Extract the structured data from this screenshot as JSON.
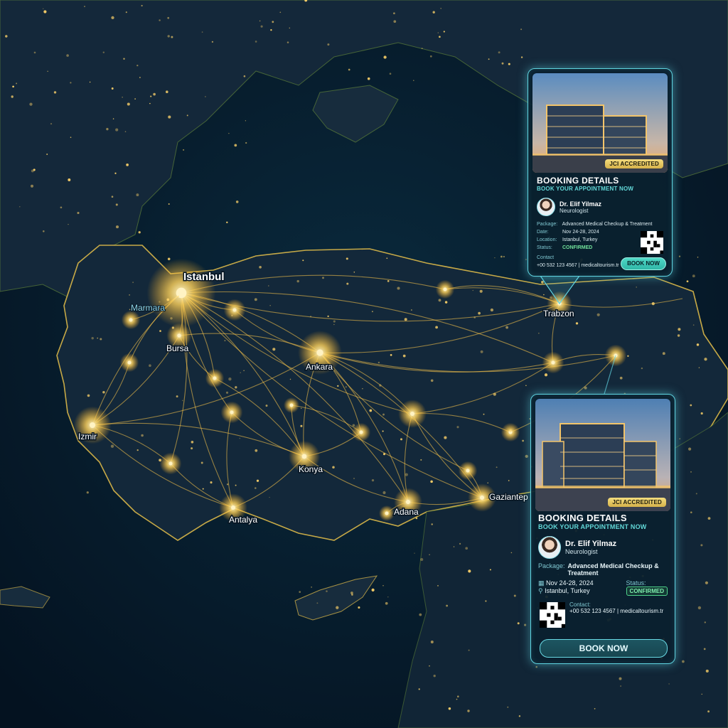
{
  "map": {
    "sea_label": "Marmara",
    "cities": [
      {
        "name": "Istanbul"
      },
      {
        "name": "Bursa"
      },
      {
        "name": "Izmir"
      },
      {
        "name": "Ankara"
      },
      {
        "name": "Konya"
      },
      {
        "name": "Antalya"
      },
      {
        "name": "Adana"
      },
      {
        "name": "Gaziantep"
      },
      {
        "name": "Trabzon"
      }
    ]
  },
  "card1": {
    "badge": "JCI ACCREDITED",
    "title": "BOOKING DETAILS",
    "subtitle": "BOOK YOUR APPOINTMENT NOW",
    "doctor_name": "Dr. Elif Yilmaz",
    "doctor_role": "Neurologist",
    "package_label": "Package:",
    "package_value": "Advanced Medical Checkup & Treatment",
    "date_label": "Date:",
    "date_value": "Nov 24-28, 2024",
    "location_label": "Location:",
    "location_value": "Istanbul, Turkey",
    "status_label": "Status:",
    "status_value": "CONFIRMED",
    "contact_label": "Contact",
    "contact_value": "+00 532 123 4567 | medicaltourism.tr",
    "button": "BOOK NOW"
  },
  "card2": {
    "badge": "JCI ACCREDITED",
    "title": "BOOKING DETAILS",
    "subtitle": "BOOK YOUR APPOINTMENT NOW",
    "doctor_name": "Dr. Elif Yilmaz",
    "doctor_role": "Neurologist",
    "package_label": "Package:",
    "package_value": "Advanced Medical Checkup & Treatment",
    "date_value": "Nov 24-28, 2024",
    "location_value": "Istanbul, Turkey",
    "status_label": "Status:",
    "status_value": "CONFIRMED",
    "contact_label": "Contact:",
    "contact_value": "+00 532 123 4567 | medicaltourism.tr",
    "button": "BOOK NOW"
  },
  "colors": {
    "route": "#ffc84a",
    "card_border": "#5fd3e0",
    "accent": "#62d8d8"
  }
}
